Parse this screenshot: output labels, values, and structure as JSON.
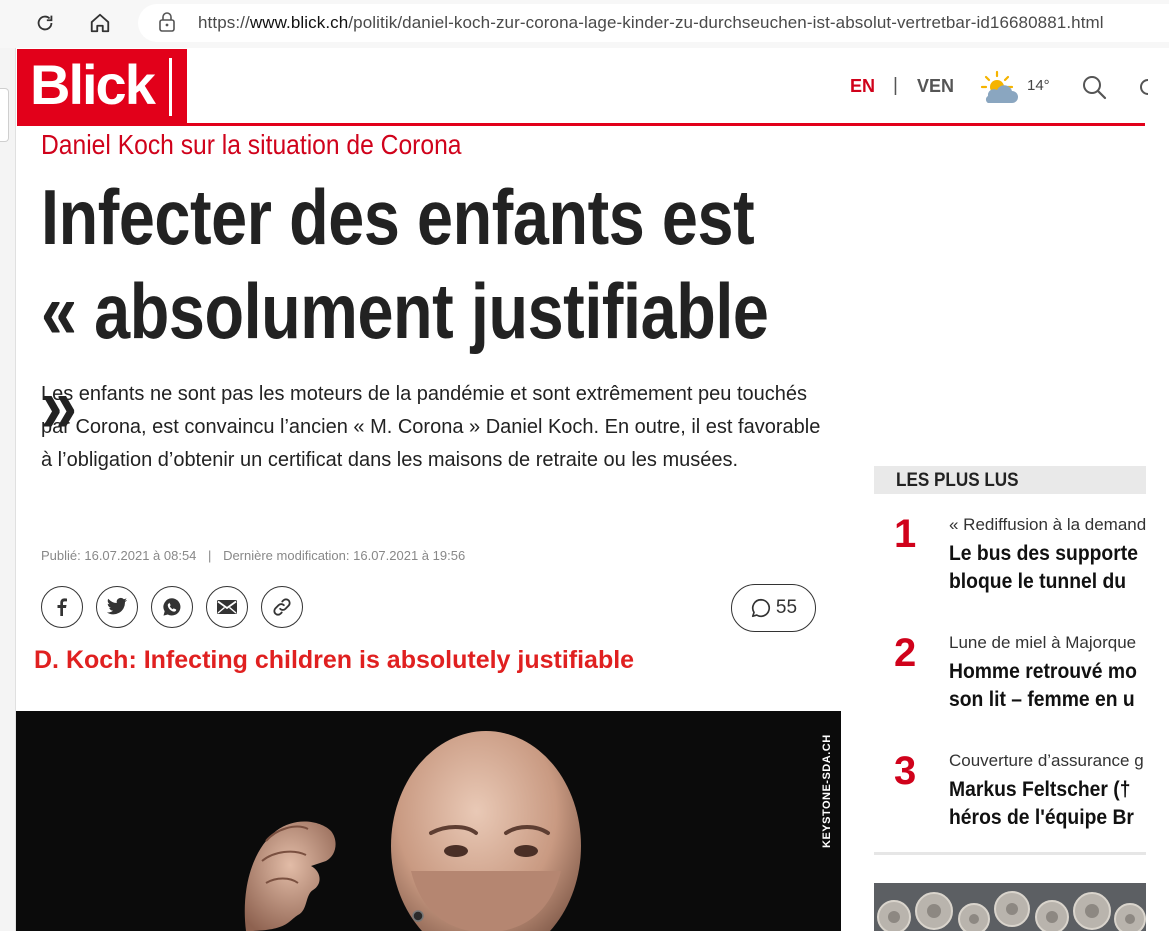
{
  "browser": {
    "url_prefix": "https://",
    "url_domain": "www.blick.ch",
    "url_path": "/politik/daniel-koch-zur-corona-lage-kinder-zu-durchseuchen-ist-absolut-vertretbar-id16680881.html"
  },
  "header": {
    "logo": "Blick",
    "lang_active": "EN",
    "lang_separator": "|",
    "lang_other": "VEN",
    "temperature": "14°",
    "weather_icon": "partly-cloudy-icon",
    "accent_color": "#e2001a"
  },
  "article": {
    "kicker": "Daniel Koch sur la situation de Corona",
    "headline": "Infecter des enfants est « absolument justifiable »",
    "lead": "Les enfants ne sont pas les moteurs de la pandémie et sont extrêmement peu touchés par Corona, est convaincu l’ancien « M. Corona » Daniel Koch. En outre, il est favorable à l’obligation d’obtenir un certificat dans les maisons de retraite ou les musées.",
    "published": "Publié: 16.07.2021 à 08:54",
    "meta_separator": "|",
    "modified": "Dernière modification: 16.07.2021 à 19:56",
    "share_icons": [
      "facebook-icon",
      "twitter-icon",
      "whatsapp-icon",
      "mail-icon",
      "link-icon"
    ],
    "comment_count": "55",
    "annotation": "D. Koch: Infecting children is absolutely justifiable",
    "photo_credit": "KEYSTONE-SDA.CH"
  },
  "most_read": {
    "title": "LES PLUS LUS",
    "items": [
      {
        "rank": "1",
        "kicker": "« Rediffusion à la demande",
        "title_line1": "Le bus des supporte",
        "title_line2": "bloque le tunnel du"
      },
      {
        "rank": "2",
        "kicker": "Lune de miel à Majorque",
        "title_line1": "Homme retrouvé mo",
        "title_line2": "son lit – femme en u"
      },
      {
        "rank": "3",
        "kicker": "Couverture d’assurance g",
        "title_line1": "Markus Feltscher (†",
        "title_line2": "héros de l'équipe Br"
      }
    ]
  }
}
